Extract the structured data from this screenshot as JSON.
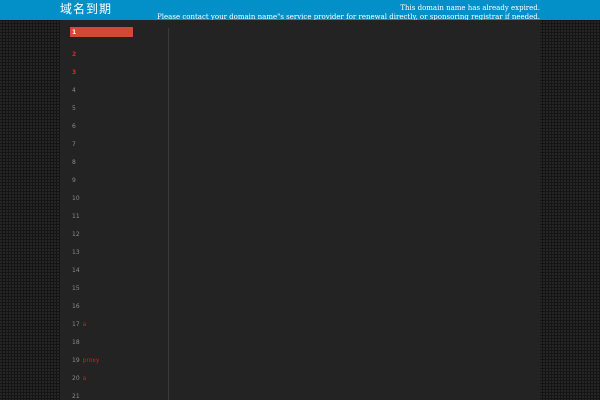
{
  "header": {
    "logo": "域名到期",
    "notice_line1": "This domain name has already expired.",
    "notice_line2": "Please contact your domain name\"s service provider for renewal directly, or sponsoring registrar if needed."
  },
  "colors": {
    "topbar": "#0390c9",
    "panel": "#232323",
    "active_item": "#d04a36",
    "accent_red": "#e0262f"
  },
  "nav": {
    "items": [
      {
        "num": "1",
        "label": ""
      },
      {
        "num": "2",
        "label": ""
      },
      {
        "num": "3",
        "label": ""
      },
      {
        "num": "4",
        "label": ""
      },
      {
        "num": "5",
        "label": ""
      },
      {
        "num": "6",
        "label": ""
      },
      {
        "num": "7",
        "label": ""
      },
      {
        "num": "8",
        "label": ""
      },
      {
        "num": "9",
        "label": ""
      },
      {
        "num": "10",
        "label": ""
      },
      {
        "num": "11",
        "label": ""
      },
      {
        "num": "12",
        "label": ""
      },
      {
        "num": "13",
        "label": ""
      },
      {
        "num": "14",
        "label": ""
      },
      {
        "num": "15",
        "label": ""
      },
      {
        "num": "16",
        "label": ""
      },
      {
        "num": "17",
        "label": "a"
      },
      {
        "num": "18",
        "label": ""
      },
      {
        "num": "19",
        "label": "proxy"
      },
      {
        "num": "20",
        "label": "a"
      },
      {
        "num": "21",
        "label": ""
      }
    ]
  }
}
